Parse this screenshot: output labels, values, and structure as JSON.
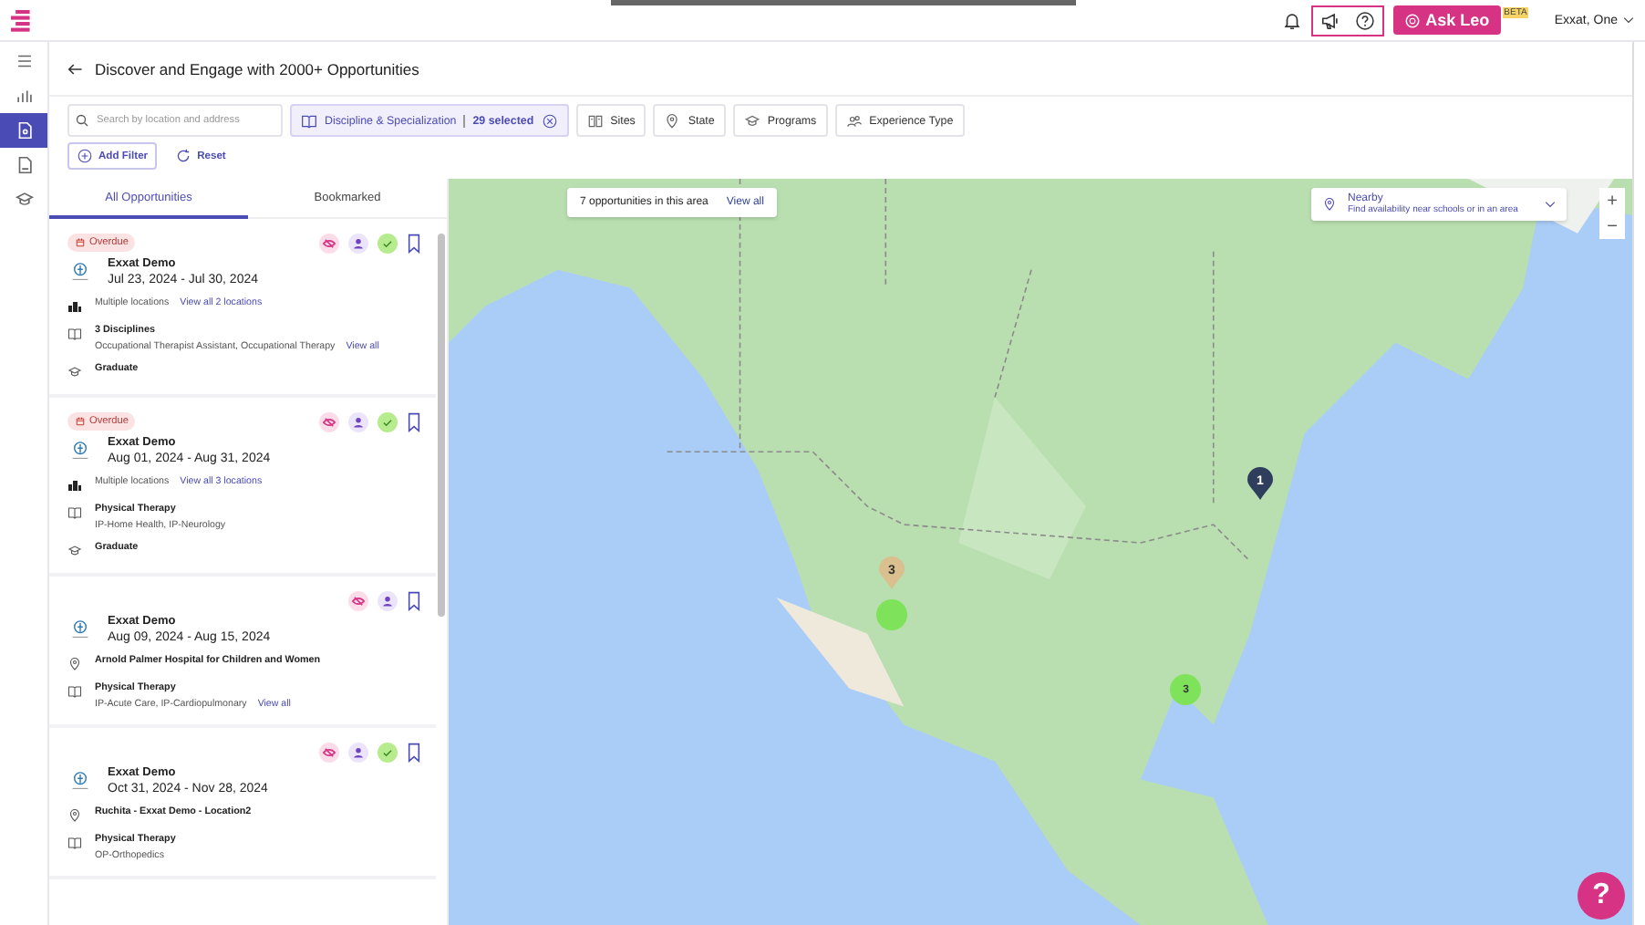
{
  "top_bar": {
    "ask_button": "Ask Leo",
    "beta_badge": "BETA",
    "user": "Exxat, One"
  },
  "sidebar": {
    "items": [
      {
        "kind": "menu",
        "selected": false
      },
      {
        "kind": "chart",
        "selected": false
      },
      {
        "kind": "document",
        "selected": true
      },
      {
        "kind": "file",
        "selected": false
      },
      {
        "kind": "cap",
        "selected": false
      }
    ]
  },
  "header": {
    "title": "Discover and Engage with 2000+ Opportunities"
  },
  "filters": {
    "search": {
      "placeholder": "Search by location and address"
    },
    "discipline": {
      "label": "Discipline & Specialization",
      "count": "29 selected"
    },
    "chips": [
      {
        "kind": "sites",
        "label": "Sites"
      },
      {
        "kind": "state",
        "label": "State"
      },
      {
        "kind": "programs",
        "label": "Programs"
      },
      {
        "kind": "experience",
        "label": "Experience Type"
      }
    ],
    "add_filter": "Add Filter",
    "reset": "Reset"
  },
  "tabs": [
    {
      "label": "All Opportunities",
      "selected": true
    },
    {
      "label": "Bookmarked",
      "selected": false
    }
  ],
  "cards": [
    {
      "overdue": "Overdue",
      "confirmed": true,
      "bookmarked": false,
      "name": "Exxat Demo",
      "dates": "Jul 23, 2024 - Jul 30, 2024",
      "rows": [
        {
          "kind": "locations",
          "text": "Multiple locations",
          "link": "View all 2 locations"
        },
        {
          "kind": "discipline",
          "title": "3 Disciplines",
          "detail": "Occupational Therapist Assistant, Occupational Therapy",
          "link": "View all"
        },
        {
          "kind": "program",
          "title": "Graduate"
        }
      ]
    },
    {
      "overdue": "Overdue",
      "confirmed": true,
      "bookmarked": false,
      "name": "Exxat Demo",
      "dates": "Aug 01, 2024 - Aug 31, 2024",
      "rows": [
        {
          "kind": "locations",
          "text": "Multiple locations",
          "link": "View all 3 locations"
        },
        {
          "kind": "discipline",
          "title": "Physical Therapy",
          "detail": "IP-Home Health, IP-Neurology"
        },
        {
          "kind": "program",
          "title": "Graduate"
        }
      ]
    },
    {
      "confirmed": false,
      "bookmarked": false,
      "name": "Exxat Demo",
      "dates": "Aug 09, 2024 - Aug 15, 2024",
      "rows": [
        {
          "kind": "site",
          "title": "Arnold Palmer Hospital for Children and Women"
        },
        {
          "kind": "discipline",
          "title": "Physical Therapy",
          "detail": "IP-Acute Care, IP-Cardiopulmonary",
          "link": "View all"
        }
      ]
    },
    {
      "confirmed": true,
      "bookmarked": false,
      "name": "Exxat Demo",
      "dates": "Oct 31, 2024 - Nov 28, 2024",
      "rows": [
        {
          "kind": "site",
          "title": "Ruchita - Exxat Demo - Location2"
        },
        {
          "kind": "discipline",
          "title": "Physical Therapy",
          "detail": "OP-Orthopedics"
        }
      ]
    }
  ],
  "map": {
    "summary": "7 opportunities in this area",
    "view_all": "View all",
    "nearby": {
      "title": "Nearby",
      "subtitle": "Find availability near schools or in an area"
    },
    "zoom_in": "+",
    "zoom_out": "−",
    "markers": [
      {
        "kind": "cluster",
        "color": "#7ee35a"
      },
      {
        "kind": "pin",
        "label": "3",
        "color": "#d9c08e"
      },
      {
        "kind": "cluster",
        "label": "3",
        "color": "#7ee35a"
      },
      {
        "kind": "pin",
        "label": "1",
        "color": "#2f3e5c"
      }
    ]
  },
  "help_button": "?"
}
